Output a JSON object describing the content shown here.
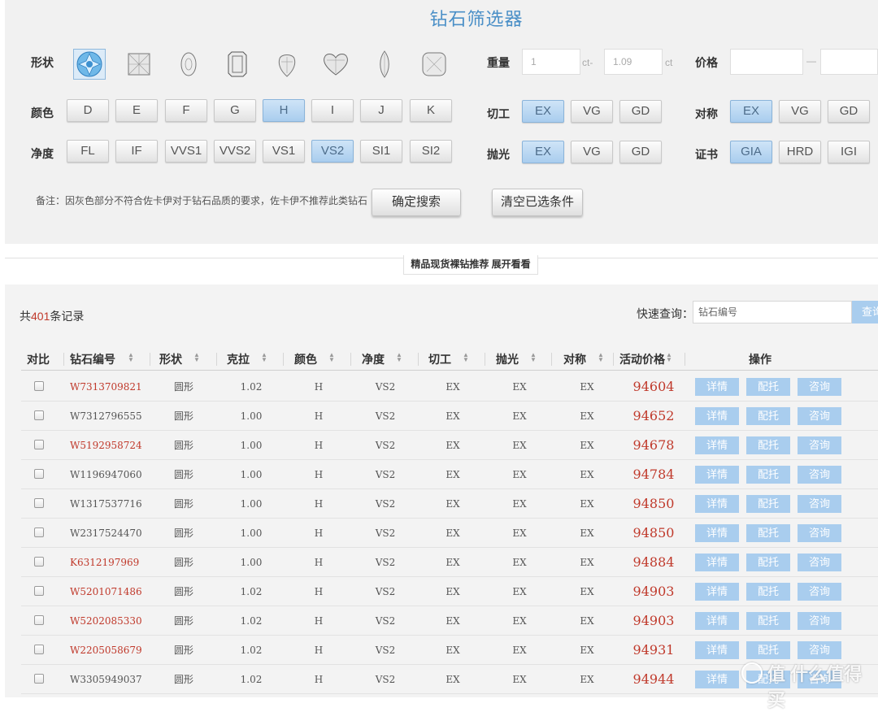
{
  "filter": {
    "title": "钻石筛选器",
    "labels": {
      "shape": "形状",
      "color": "颜色",
      "clarity": "净度",
      "weight": "重量",
      "price": "价格",
      "cut": "切工",
      "symmetry": "对称",
      "polish": "抛光",
      "cert": "证书"
    },
    "shapes": [
      "round-icon",
      "princess-icon",
      "oval-icon",
      "emerald-icon",
      "pear-icon",
      "heart-icon",
      "marquise-icon",
      "cushion-icon"
    ],
    "colors": [
      "D",
      "E",
      "F",
      "G",
      "H",
      "I",
      "J",
      "K"
    ],
    "clarities": [
      "FL",
      "IF",
      "VVS1",
      "VVS2",
      "VS1",
      "VS2",
      "SI1",
      "SI2"
    ],
    "cuts": [
      "EX",
      "VG",
      "GD"
    ],
    "polishes": [
      "EX",
      "VG",
      "GD"
    ],
    "symmetries": [
      "EX",
      "VG",
      "GD"
    ],
    "certs": [
      "GIA",
      "HRD",
      "IGI"
    ],
    "weight": {
      "min": "1",
      "max": "1.09",
      "unit": "ct",
      "dash": "ct-"
    },
    "price_dash": "—",
    "note": "备注：因灰色部分不符合佐卡伊对于钻石品质的要求，佐卡伊不推荐此类钻石",
    "search_label": "确定搜索",
    "clear_label": "清空已选条件"
  },
  "recommend_tab": "精品现货裸钻推荐  展开看看",
  "results": {
    "count_prefix": "共",
    "count": "401",
    "count_suffix": "条记录",
    "quick_label": "快速查询：",
    "quick_placeholder": "钻石编号",
    "quick_button": "查询",
    "headers": [
      "对比",
      "钻石编号",
      "形状",
      "克拉",
      "颜色",
      "净度",
      "切工",
      "抛光",
      "对称",
      "活动价格",
      "操作"
    ],
    "actions": [
      "详情",
      "配托",
      "咨询"
    ],
    "rows": [
      {
        "code": "W7313709821",
        "shape": "圆形",
        "carat": "1.02",
        "color": "H",
        "clarity": "VS2",
        "cut": "EX",
        "polish": "EX",
        "sym": "EX",
        "price": "94604"
      },
      {
        "code": "W7312796555",
        "shape": "圆形",
        "carat": "1.00",
        "color": "H",
        "clarity": "VS2",
        "cut": "EX",
        "polish": "EX",
        "sym": "EX",
        "price": "94652"
      },
      {
        "code": "W5192958724",
        "shape": "圆形",
        "carat": "1.00",
        "color": "H",
        "clarity": "VS2",
        "cut": "EX",
        "polish": "EX",
        "sym": "EX",
        "price": "94678"
      },
      {
        "code": "W1196947060",
        "shape": "圆形",
        "carat": "1.00",
        "color": "H",
        "clarity": "VS2",
        "cut": "EX",
        "polish": "EX",
        "sym": "EX",
        "price": "94784"
      },
      {
        "code": "W1317537716",
        "shape": "圆形",
        "carat": "1.00",
        "color": "H",
        "clarity": "VS2",
        "cut": "EX",
        "polish": "EX",
        "sym": "EX",
        "price": "94850"
      },
      {
        "code": "W2317524470",
        "shape": "圆形",
        "carat": "1.00",
        "color": "H",
        "clarity": "VS2",
        "cut": "EX",
        "polish": "EX",
        "sym": "EX",
        "price": "94850"
      },
      {
        "code": "K6312197969",
        "shape": "圆形",
        "carat": "1.00",
        "color": "H",
        "clarity": "VS2",
        "cut": "EX",
        "polish": "EX",
        "sym": "EX",
        "price": "94884"
      },
      {
        "code": "W5201071486",
        "shape": "圆形",
        "carat": "1.02",
        "color": "H",
        "clarity": "VS2",
        "cut": "EX",
        "polish": "EX",
        "sym": "EX",
        "price": "94903"
      },
      {
        "code": "W5202085330",
        "shape": "圆形",
        "carat": "1.02",
        "color": "H",
        "clarity": "VS2",
        "cut": "EX",
        "polish": "EX",
        "sym": "EX",
        "price": "94903"
      },
      {
        "code": "W2205058679",
        "shape": "圆形",
        "carat": "1.02",
        "color": "H",
        "clarity": "VS2",
        "cut": "EX",
        "polish": "EX",
        "sym": "EX",
        "price": "94931"
      },
      {
        "code": "W3305949037",
        "shape": "圆形",
        "carat": "1.02",
        "color": "H",
        "clarity": "VS2",
        "cut": "EX",
        "polish": "EX",
        "sym": "EX",
        "price": "94944"
      }
    ]
  },
  "watermark": "值 什么值得买",
  "colors": {
    "accent": "#4a8fc7",
    "selected": "#a9cdee",
    "price": "#c0392b"
  }
}
